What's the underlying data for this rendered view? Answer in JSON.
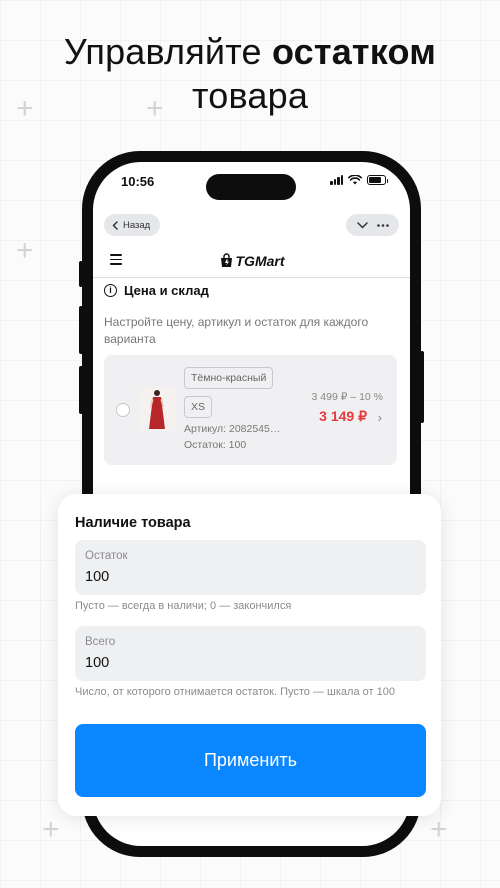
{
  "headline": {
    "line1_normal": "Управляйте ",
    "line1_bold": "остатком",
    "line2": "товара"
  },
  "status_bar": {
    "time": "10:56"
  },
  "telegram_bar": {
    "back_label": "Назад"
  },
  "app": {
    "logo_text": "TGMart"
  },
  "section": {
    "title": "Цена и склад",
    "description": "Настройте цену, артикул и остаток для каждого варианта"
  },
  "variant": {
    "color_chip": "Тёмно-красный",
    "size_chip": "XS",
    "sku": "Артикул: 2082545…",
    "stock": "Остаток: 100",
    "old_price": "3 499 ₽ – 10 %",
    "new_price": "3 149 ₽"
  },
  "modal": {
    "title": "Наличие товара",
    "fields": [
      {
        "label": "Остаток",
        "value": "100",
        "hint": "Пусто — всегда в наличи; 0 — закончился"
      },
      {
        "label": "Всего",
        "value": "100",
        "hint": "Число, от которого отнимается остаток. Пусто — шкала от 100"
      }
    ],
    "apply_label": "Применить"
  },
  "colors": {
    "accent": "#0a86ff",
    "price_red": "#e5393b",
    "card_bg": "#f0f0f2"
  }
}
